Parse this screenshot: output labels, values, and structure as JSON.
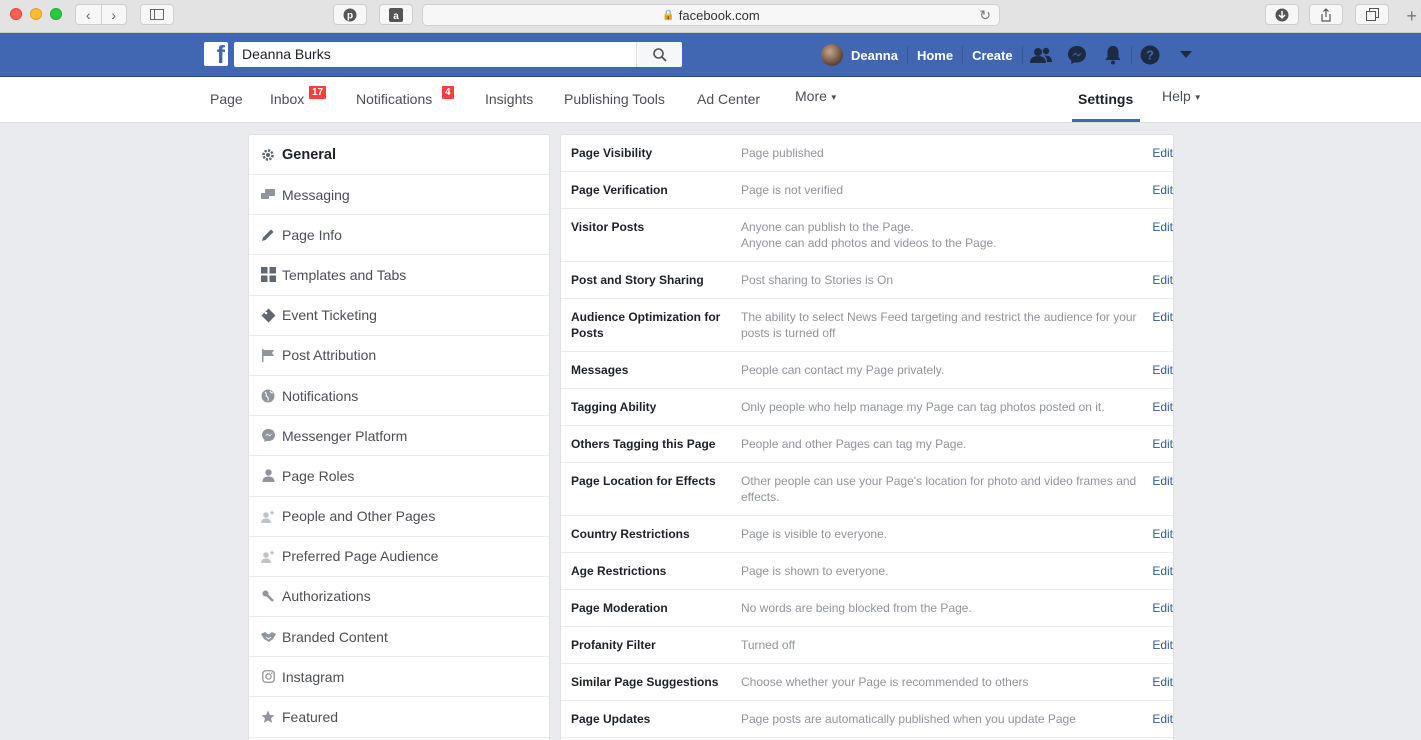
{
  "browser": {
    "url": "facebook.com"
  },
  "topbar": {
    "search_value": "Deanna Burks",
    "user_name": "Deanna",
    "home": "Home",
    "create": "Create"
  },
  "pagenav": {
    "page": "Page",
    "inbox": "Inbox",
    "inbox_count": "17",
    "notifications": "Notifications",
    "notifications_count": "4",
    "insights": "Insights",
    "publishing_tools": "Publishing Tools",
    "ad_center": "Ad Center",
    "more": "More",
    "settings": "Settings",
    "help": "Help"
  },
  "sidebar": {
    "items": [
      {
        "label": "General",
        "icon": "gear-icon"
      },
      {
        "label": "Messaging",
        "icon": "chat-icon"
      },
      {
        "label": "Page Info",
        "icon": "pencil-icon"
      },
      {
        "label": "Templates and Tabs",
        "icon": "grid-icon"
      },
      {
        "label": "Event Ticketing",
        "icon": "ticket-icon"
      },
      {
        "label": "Post Attribution",
        "icon": "flag-icon"
      },
      {
        "label": "Notifications",
        "icon": "globe-icon"
      },
      {
        "label": "Messenger Platform",
        "icon": "messenger-icon"
      },
      {
        "label": "Page Roles",
        "icon": "person-icon"
      },
      {
        "label": "People and Other Pages",
        "icon": "person-star-icon"
      },
      {
        "label": "Preferred Page Audience",
        "icon": "person-star-icon"
      },
      {
        "label": "Authorizations",
        "icon": "wrench-icon"
      },
      {
        "label": "Branded Content",
        "icon": "handshake-icon"
      },
      {
        "label": "Instagram",
        "icon": "instagram-icon"
      },
      {
        "label": "Featured",
        "icon": "star-icon"
      }
    ]
  },
  "settings": {
    "edit_label": "Edit",
    "rows": [
      {
        "label": "Page Visibility",
        "value": "Page published"
      },
      {
        "label": "Page Verification",
        "value": "Page is not verified"
      },
      {
        "label": "Visitor Posts",
        "value": "Anyone can publish to the Page.\nAnyone can add photos and videos to the Page."
      },
      {
        "label": "Post and Story Sharing",
        "value": "Post sharing to Stories is On"
      },
      {
        "label": "Audience Optimization for Posts",
        "value": "The ability to select News Feed targeting and restrict the audience for your posts is turned off"
      },
      {
        "label": "Messages",
        "value": "People can contact my Page privately."
      },
      {
        "label": "Tagging Ability",
        "value": "Only people who help manage my Page can tag photos posted on it."
      },
      {
        "label": "Others Tagging this Page",
        "value": "People and other Pages can tag my Page."
      },
      {
        "label": "Page Location for Effects",
        "value": "Other people can use your Page's location for photo and video frames and effects."
      },
      {
        "label": "Country Restrictions",
        "value": "Page is visible to everyone."
      },
      {
        "label": "Age Restrictions",
        "value": "Page is shown to everyone."
      },
      {
        "label": "Page Moderation",
        "value": "No words are being blocked from the Page."
      },
      {
        "label": "Profanity Filter",
        "value": "Turned off"
      },
      {
        "label": "Similar Page Suggestions",
        "value": "Choose whether your Page is recommended to others"
      },
      {
        "label": "Page Updates",
        "value": "Page posts are automatically published when you update Page"
      }
    ]
  }
}
